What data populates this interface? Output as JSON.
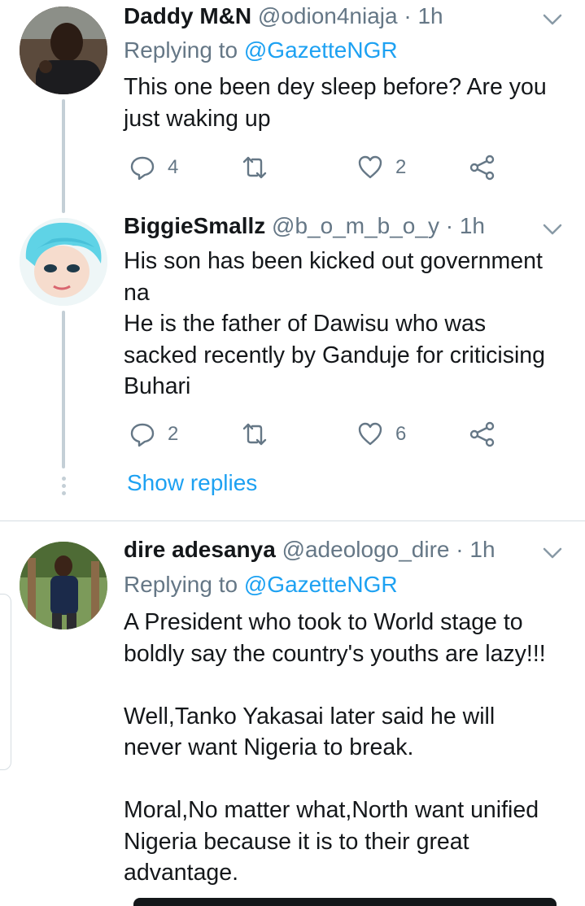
{
  "tweets": [
    {
      "name": "Daddy M&N",
      "handle": "@odion4niaja",
      "time": "· 1h",
      "replying_label": "Replying to",
      "replying_handle": "@GazetteNGR",
      "text": "This one been dey sleep before? Are you\njust waking up",
      "replies": "4",
      "likes": "2"
    },
    {
      "name": "BiggieSmallz",
      "handle": "@b_o_m_b_o_y",
      "time": "· 1h",
      "text": "His son has been kicked out government\nna\nHe is the father of Dawisu who was\nsacked recently by Ganduje for criticising\nBuhari",
      "replies": "2",
      "likes": "6"
    },
    {
      "name": "dire adesanya",
      "handle": "@adeologo_dire",
      "time": "· 1h",
      "replying_label": "Replying to",
      "replying_handle": "@GazetteNGR",
      "text": "A President who took to World stage to\nboldly say the country's youths are lazy!!!\n\nWell,Tanko Yakasai later said he will\nnever want Nigeria to break.\n\nMoral,No matter what,North want unified\nNigeria because it is to their great\nadvantage."
    }
  ],
  "show_replies_label": "Show replies",
  "colors": {
    "accent": "#1da1f2",
    "secondary_text": "#657786",
    "primary_text": "#14171a",
    "divider": "#d6dde2"
  },
  "icons": [
    "reply-icon",
    "retweet-icon",
    "like-icon",
    "share-icon",
    "chevron-down-icon"
  ]
}
